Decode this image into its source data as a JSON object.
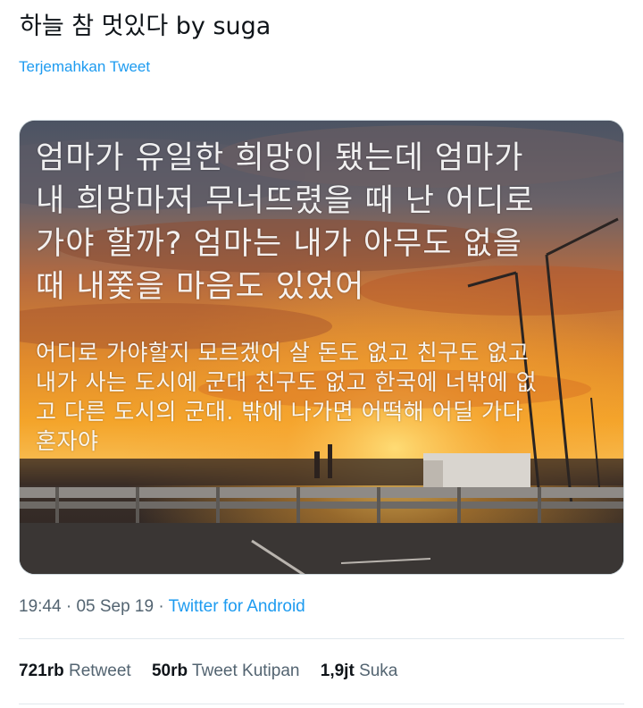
{
  "tweet": {
    "text": "하늘 참 멋있다 by suga",
    "translate_label": "Terjemahkan Tweet"
  },
  "media": {
    "overlay_big": "엄마가 유일한 희망이 됐는데 엄마가\n내 희망마저 무너뜨렸을 때 난 어디로\n가야 할까? 엄마는 내가 아무도 없을\n때 내쫓을 마음도 있었어",
    "overlay_small": "어디로 가야할지 모르겠어 살 돈도 없고 친구도 없고\n내가 사는 도시에 군대 친구도 없고 한국에 너밖에 없\n고 다른 도시의 군대. 밖에 나가면 어떡해 어딜 가다\n혼자야"
  },
  "meta": {
    "time": "19:44",
    "separator": "·",
    "date": "05 Sep 19",
    "source": "Twitter for Android"
  },
  "stats": {
    "retweets_count": "721rb",
    "retweets_label": "Retweet",
    "quotes_count": "50rb",
    "quotes_label": "Tweet Kutipan",
    "likes_count": "1,9jt",
    "likes_label": "Suka"
  },
  "colors": {
    "link": "#1d9bf0",
    "secondary_text": "#536471",
    "primary_text": "#0f1419"
  }
}
